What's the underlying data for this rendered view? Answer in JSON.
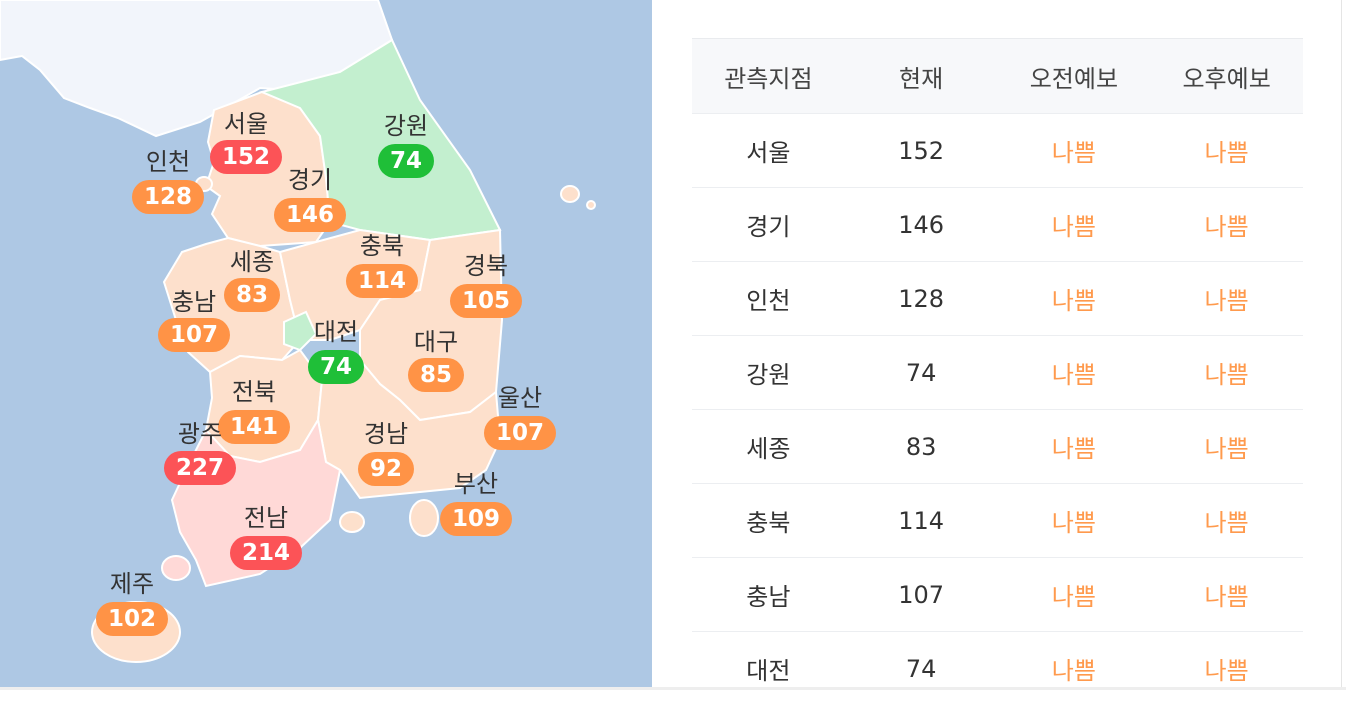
{
  "colors": {
    "sea": "#aec8e4",
    "good": "#1fbf38",
    "moderate": "#ff9346",
    "bad": "#fc5357",
    "grade_text": "#ff9a4d"
  },
  "map": {
    "regions": [
      {
        "name": "서울",
        "value": "152",
        "level": "bad"
      },
      {
        "name": "인천",
        "value": "128",
        "level": "moderate"
      },
      {
        "name": "경기",
        "value": "146",
        "level": "moderate"
      },
      {
        "name": "강원",
        "value": "74",
        "level": "good"
      },
      {
        "name": "충북",
        "value": "114",
        "level": "moderate"
      },
      {
        "name": "세종",
        "value": "83",
        "level": "moderate"
      },
      {
        "name": "경북",
        "value": "105",
        "level": "moderate"
      },
      {
        "name": "충남",
        "value": "107",
        "level": "moderate"
      },
      {
        "name": "대전",
        "value": "74",
        "level": "good"
      },
      {
        "name": "대구",
        "value": "85",
        "level": "moderate"
      },
      {
        "name": "울산",
        "value": "107",
        "level": "moderate"
      },
      {
        "name": "전북",
        "value": "141",
        "level": "moderate"
      },
      {
        "name": "광주",
        "value": "227",
        "level": "bad"
      },
      {
        "name": "경남",
        "value": "92",
        "level": "moderate"
      },
      {
        "name": "부산",
        "value": "109",
        "level": "moderate"
      },
      {
        "name": "전남",
        "value": "214",
        "level": "bad"
      },
      {
        "name": "제주",
        "value": "102",
        "level": "moderate"
      }
    ]
  },
  "table": {
    "headers": [
      "관측지점",
      "현재",
      "오전예보",
      "오후예보"
    ],
    "rows": [
      [
        "서울",
        "152",
        "나쁨",
        "나쁨"
      ],
      [
        "경기",
        "146",
        "나쁨",
        "나쁨"
      ],
      [
        "인천",
        "128",
        "나쁨",
        "나쁨"
      ],
      [
        "강원",
        "74",
        "나쁨",
        "나쁨"
      ],
      [
        "세종",
        "83",
        "나쁨",
        "나쁨"
      ],
      [
        "충북",
        "114",
        "나쁨",
        "나쁨"
      ],
      [
        "충남",
        "107",
        "나쁨",
        "나쁨"
      ],
      [
        "대전",
        "74",
        "나쁨",
        "나쁨"
      ]
    ]
  }
}
